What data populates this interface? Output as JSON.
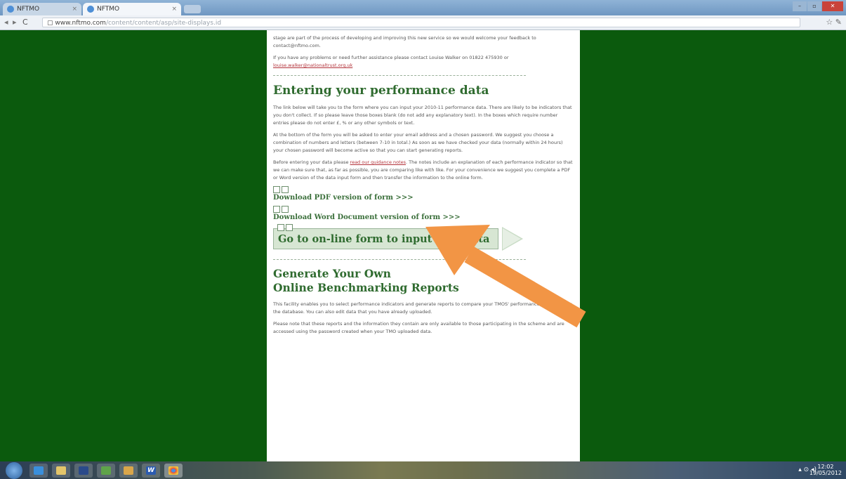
{
  "browser": {
    "tabs": [
      {
        "label": "NFTMO"
      },
      {
        "label": "NFTMO"
      }
    ],
    "close_glyph": "×",
    "url_host": "www.nftmo.com",
    "url_path": "/content/content/asp/site-displays.id",
    "nav": {
      "back": "◂",
      "forward": "▸",
      "reload": "C",
      "page": "▢"
    },
    "toolbar_right": {
      "star": "☆",
      "wrench": "✎"
    },
    "window": {
      "minimize": "–",
      "maximize": "▫",
      "close": "✕"
    }
  },
  "page": {
    "intro_para1": "stage are part of the process of developing and improving this new service so we would welcome your feedback to contact@nftmo.com.",
    "intro_para2_text": "If you have any problems or need further assistance please contact Louise Walker on 01822 475930 or",
    "intro_para2_link": "louise.walker@nationaltrust.org.uk",
    "entering": {
      "heading": "Entering your performance data",
      "para1": "The link below will take you to the form where you can input your 2010-11 performance data. There are likely to be indicators that you don't collect. If so please leave those boxes blank (do not add any explanatory text). In the boxes which require number entries please do not enter £, % or any other symbols or text.",
      "para2": "At the bottom of the form you will be asked to enter your email address and a chosen password. We suggest you choose a combination of numbers and letters (between 7-10 in total.) As soon as we have checked your data (normally within 24 hours) your chosen password will become active so that you can start generating reports.",
      "para3_before": "Before entering your data please",
      "para3_link": "read our guidance notes",
      "para3_after": ". The notes include an explanation of each performance indicator so that we can make sure that, as far as possible, you are comparing like with like. For your convenience we suggest you complete a PDF or Word version of the data input form and then transfer the information to the online form.",
      "download_pdf": "Download PDF version of form >>>",
      "download_word": "Download Word Document version of form >>>",
      "online_form": "Go to on-line form to input your data"
    },
    "generate": {
      "heading_line1": "Generate Your Own",
      "heading_line2": "Online Benchmarking Reports",
      "para1": "This facility enables you to select performance indicators and generate reports to compare your TMOS' performance with others in the database. You can also edit data that you have already uploaded.",
      "para2": "Please note that these reports and the information they contain are only available to those participating in the scheme and are accessed using the password created when your TMO uploaded data."
    }
  },
  "annotation": {
    "arrow_color": "#f29545"
  },
  "taskbar": {
    "word_glyph": "W",
    "tray": "▴ ⊙ ◂)",
    "clock_time": "12:02",
    "clock_date": "19/05/2012"
  }
}
